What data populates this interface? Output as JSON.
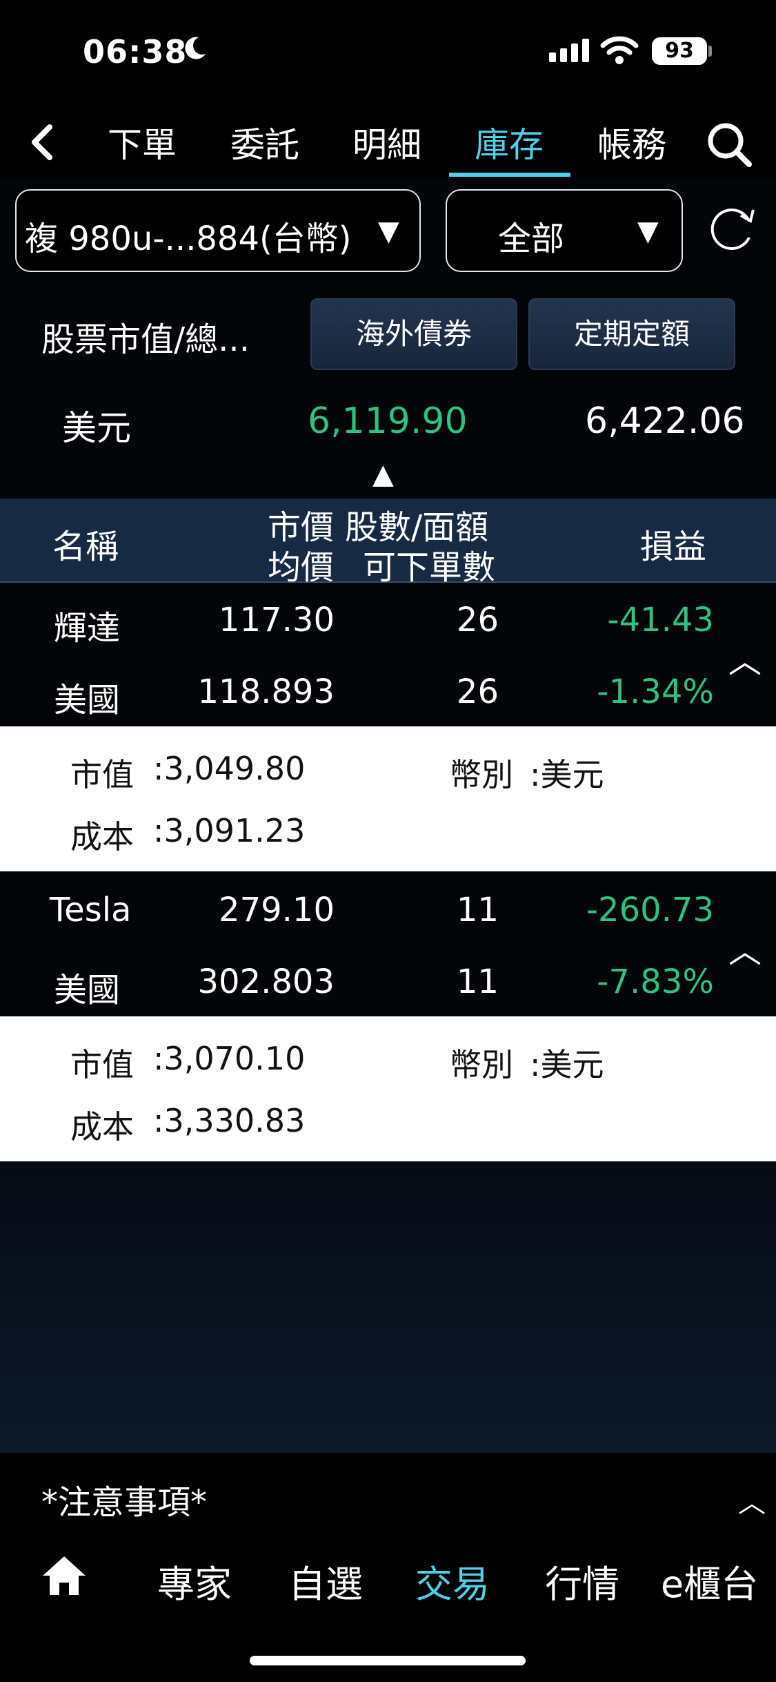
{
  "status": {
    "time": "06:38",
    "battery": "93"
  },
  "tabs": [
    "下單",
    "委託",
    "明細",
    "庫存",
    "帳務"
  ],
  "account": {
    "label": "複 980u-...884(台幣)",
    "filter": "全部"
  },
  "summary": {
    "label": "股票市值/總...",
    "btn_bonds": "海外債券",
    "btn_regular": "定期定額",
    "currency": "美元",
    "value": "6,119.90",
    "total": "6,422.06"
  },
  "header": {
    "name": "名稱",
    "price": "市價",
    "shares": "股數/面額",
    "avg": "均價",
    "orderable": "可下單數",
    "pnl": "損益"
  },
  "rows": [
    {
      "name": "輝達",
      "market": "美國",
      "price": "117.30",
      "avg": "118.893",
      "shares": "26",
      "orderable": "26",
      "pnl": "-41.43",
      "pnl_pct": "-1.34%",
      "mkt_value_label": "市值",
      "mkt_value": ":3,049.80",
      "cost_label": "成本",
      "cost": ":3,091.23",
      "currency_label": "幣別",
      "currency": ":美元"
    },
    {
      "name": "Tesla",
      "market": "美國",
      "price": "279.10",
      "avg": "302.803",
      "shares": "11",
      "orderable": "11",
      "pnl": "-260.73",
      "pnl_pct": "-7.83%",
      "mkt_value_label": "市值",
      "mkt_value": ":3,070.10",
      "cost_label": "成本",
      "cost": ":3,330.83",
      "currency_label": "幣別",
      "currency": ":美元"
    }
  ],
  "notice": "*注意事項*",
  "bottom_nav": [
    "專家",
    "自選",
    "交易",
    "行情",
    "e櫃台"
  ],
  "colors": {
    "accent": "#4fd0e8",
    "negative": "#2ec27e",
    "header_bg": "#172a43"
  }
}
